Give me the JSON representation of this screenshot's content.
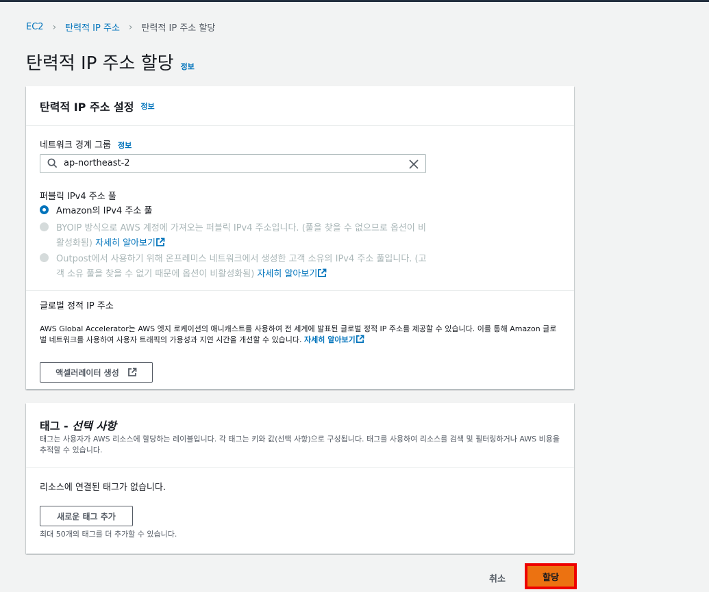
{
  "breadcrumb": {
    "items": [
      "EC2",
      "탄력적 IP 주소",
      "탄력적 IP 주소 할당"
    ]
  },
  "page": {
    "title": "탄력적 IP 주소 할당",
    "info": "정보"
  },
  "settings_panel": {
    "title": "탄력적 IP 주소 설정",
    "info": "정보",
    "network_border_group": {
      "label": "네트워크 경계 그룹",
      "info": "정보",
      "value": "ap-northeast-2"
    },
    "public_pool": {
      "label": "퍼블릭 IPv4 주소 풀",
      "options": [
        {
          "text": "Amazon의 IPv4 주소 풀",
          "selected": true,
          "disabled": false
        },
        {
          "text": "BYOIP 방식으로 AWS 계정에 가져오는 퍼블릭 IPv4 주소입니다. (풀을 찾을 수 없으므로 옵션이 비활성화됨)",
          "link": "자세히 알아보기",
          "selected": false,
          "disabled": true
        },
        {
          "text": "Outpost에서 사용하기 위해 온프레미스 네트워크에서 생성한 고객 소유의 IPv4 주소 풀입니다. (고객 소유 풀을 찾을 수 없기 때문에 옵션이 비활성화됨)",
          "link": "자세히 알아보기",
          "selected": false,
          "disabled": true
        }
      ]
    },
    "global_static": {
      "label": "글로벌 정적 IP 주소",
      "description": "AWS Global Accelerator는 AWS 엣지 로케이션의 애니캐스트를 사용하여 전 세계에 발표된 글로벌 정적 IP 주소를 제공할 수 있습니다. 이를 통해 Amazon 글로벌 네트워크를 사용하여 사용자 트래픽의 가용성과 지연 시간을 개선할 수 있습니다.",
      "link": "자세히 알아보기",
      "button": "액셀러레이터 생성"
    }
  },
  "tags_panel": {
    "title_prefix": "태그 - ",
    "title_italic": "선택 사항",
    "description": "태그는 사용자가 AWS 리소스에 할당하는 레이블입니다. 각 태그는 키와 값(선택 사항)으로 구성됩니다. 태그를 사용하여 리소스를 검색 및 필터링하거나 AWS 비용을 추적할 수 있습니다.",
    "empty_text": "리소스에 연결된 태그가 없습니다.",
    "add_button": "새로운 태그 추가",
    "limit_note": "최대 50개의 태그를 더 추가할 수 있습니다."
  },
  "footer": {
    "cancel": "취소",
    "allocate": "할당"
  },
  "colors": {
    "link": "#0073bb",
    "primary": "#ec7211",
    "highlight": "#e00000"
  }
}
